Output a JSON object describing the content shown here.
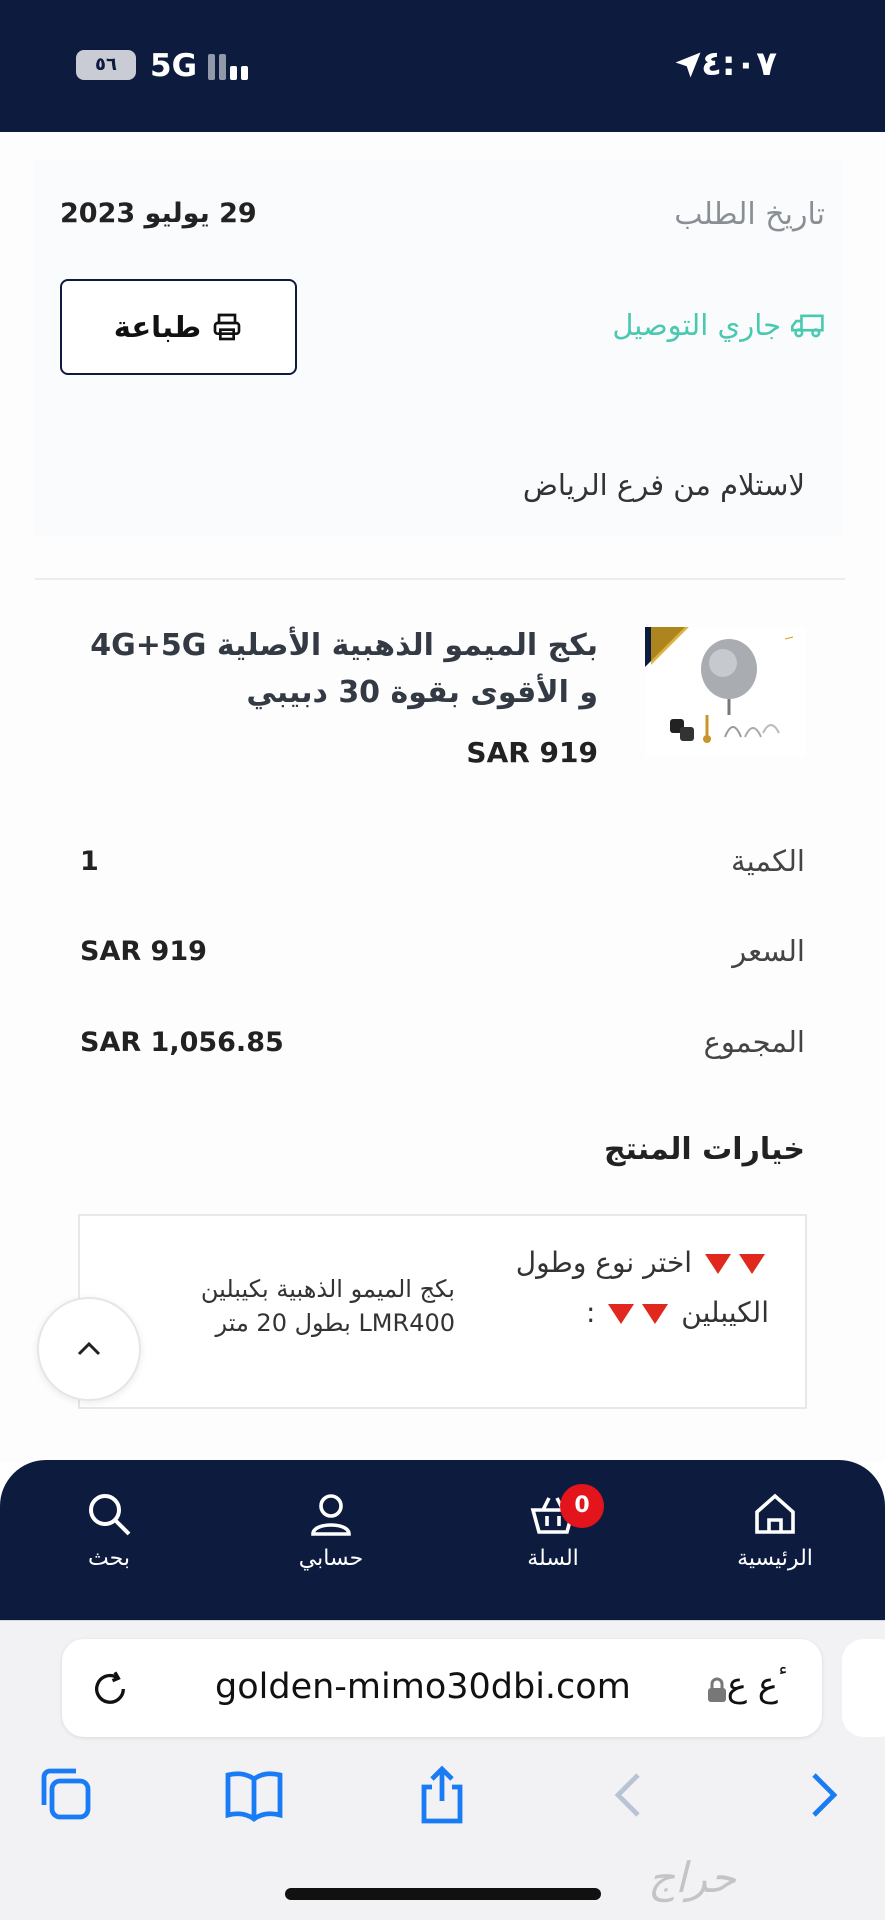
{
  "status_bar": {
    "time": "٤:٠٧",
    "network": "5G",
    "battery": "٥٦"
  },
  "order": {
    "date_label": "تاريخ الطلب",
    "date_value": "29 يوليو 2023",
    "print_label": "طباعة",
    "status_label": "جاري التوصيل",
    "pickup_text": "لاستلام من فرع الرياض"
  },
  "product": {
    "title": "بكج الميمو الذهبية الأصلية 4G+5G و الأقوى بقوة 30 دبيبي",
    "price": "SAR 919"
  },
  "summary": {
    "quantity_label": "الكمية",
    "quantity_value": "1",
    "price_label": "السعر",
    "price_value": "SAR 919",
    "total_label": "المجموع",
    "total_value": "SAR 1,056.85"
  },
  "options": {
    "title": "خيارات المنتج",
    "question_line1": "اختر نوع وطول",
    "question_line2": "الكيبلين",
    "question_suffix": ":",
    "answer": "بكج الميمو الذهبية بكيبلين LMR400 بطول 20 متر"
  },
  "bottom_nav": {
    "home": "الرئيسية",
    "cart": "السلة",
    "cart_count": "0",
    "account": "حسابي",
    "search": "بحث"
  },
  "browser": {
    "aa_label": "ٴع ع",
    "url": "golden-mimo30dbi.com",
    "watermark": "حراج"
  },
  "colors": {
    "navy": "#0d1b3e",
    "teal": "#48c9b0",
    "red": "#e3141c",
    "ios_blue": "#1a7cf5"
  },
  "icons": [
    "location-arrow-icon",
    "print-icon",
    "truck-icon",
    "chevron-up-icon",
    "home-icon",
    "cart-icon",
    "user-icon",
    "search-icon",
    "lock-icon",
    "reload-icon",
    "tabs-icon",
    "bookmarks-icon",
    "share-icon",
    "back-icon",
    "forward-icon"
  ]
}
